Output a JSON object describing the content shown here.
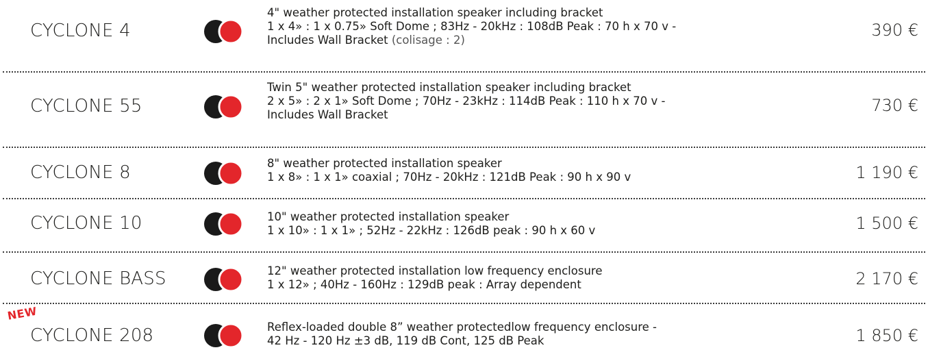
{
  "colors": {
    "black_dot": "#1a1a1a",
    "red_dot": "#e3262b",
    "new_badge": "#e3262b"
  },
  "badge": {
    "new_label": "NEW"
  },
  "products": [
    {
      "name": "CYCLONE 4",
      "desc_line1": "4\" weather protected installation speaker including bracket",
      "desc_line2": "1 x 4» : 1 x 0.75» Soft Dome ; 83Hz - 20kHz : 108dB Peak : 70 h x 70 v -",
      "desc_line3": "Includes Wall Bracket",
      "desc_line3_note": "(colisage : 2)",
      "price": "390 €"
    },
    {
      "name": "CYCLONE 55",
      "desc_line1": "Twin 5\" weather protected installation speaker including bracket",
      "desc_line2": "2 x 5» : 2 x 1» Soft Dome ; 70Hz - 23kHz : 114dB Peak : 110 h x 70 v -",
      "desc_line3": "Includes Wall Bracket",
      "price": "730 €"
    },
    {
      "name": "CYCLONE 8",
      "desc_line1": "8\" weather protected installation speaker",
      "desc_line2": "1 x 8» : 1 x 1» coaxial ; 70Hz - 20kHz : 121dB Peak : 90 h x 90 v",
      "price": "1 190 €"
    },
    {
      "name": "CYCLONE 10",
      "desc_line1": "10\" weather protected installation speaker",
      "desc_line2": "1 x 10» : 1 x 1» ; 52Hz - 22kHz : 126dB peak : 90 h x 60 v",
      "price": "1 500 €"
    },
    {
      "name": "CYCLONE BASS",
      "desc_line1": "12\" weather protected installation low frequency enclosure",
      "desc_line2": "1 x 12» ; 40Hz - 160Hz : 129dB peak : Array dependent",
      "price": "2 170 €"
    },
    {
      "name": "CYCLONE 208",
      "desc_line1": "Reflex-loaded double 8” weather protectedlow frequency enclosure -",
      "desc_line2": "42 Hz - 120 Hz ±3 dB, 119 dB Cont, 125 dB Peak",
      "price": "1 850 €"
    }
  ]
}
